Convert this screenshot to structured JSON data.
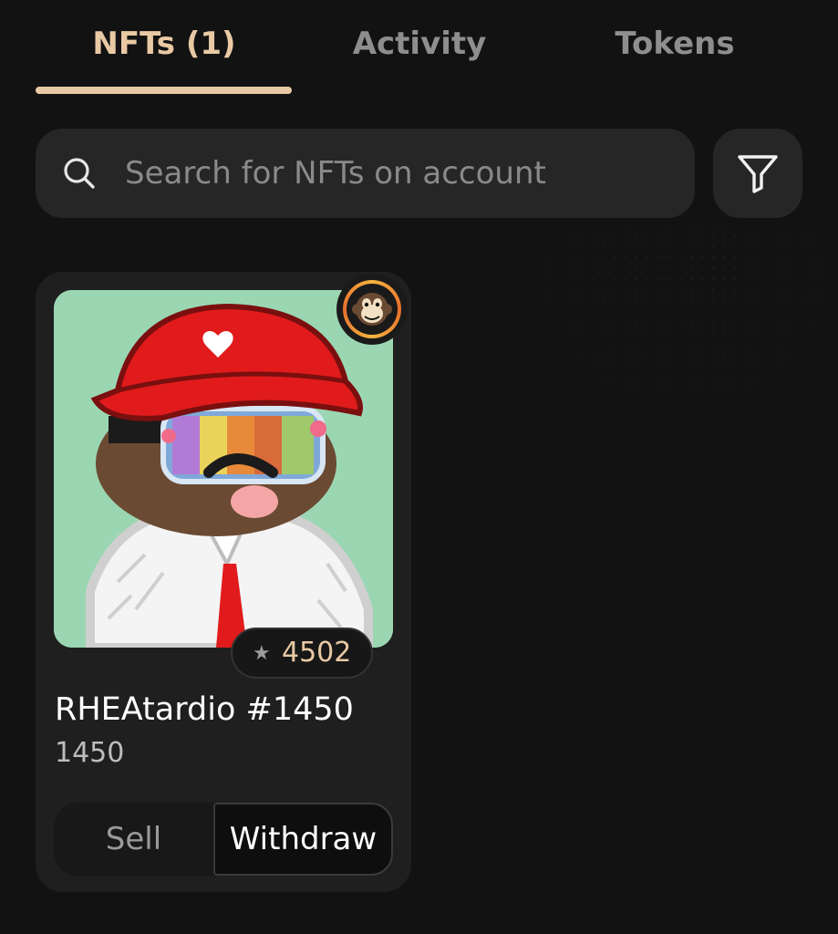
{
  "tabs": [
    {
      "label": "NFTs (1)",
      "active": true
    },
    {
      "label": "Activity",
      "active": false
    },
    {
      "label": "Tokens",
      "active": false
    }
  ],
  "search": {
    "placeholder": "Search for NFTs on account",
    "value": "",
    "icon": "search-icon"
  },
  "filter": {
    "icon": "filter-icon"
  },
  "nfts": [
    {
      "name": "RHEAtardio #1450",
      "token_id": "1450",
      "rank": "4502",
      "rank_icon": "star-icon",
      "collection_icon": "monkey-avatar-icon",
      "actions": {
        "sell": "Sell",
        "withdraw": "Withdraw"
      }
    }
  ],
  "colors": {
    "background": "#121212",
    "accent": "#e9c9a4",
    "surface": "#262626",
    "card": "#1f1f1f",
    "inactive_text": "#8e8e8e",
    "nft_background": "#9bd6b3"
  }
}
